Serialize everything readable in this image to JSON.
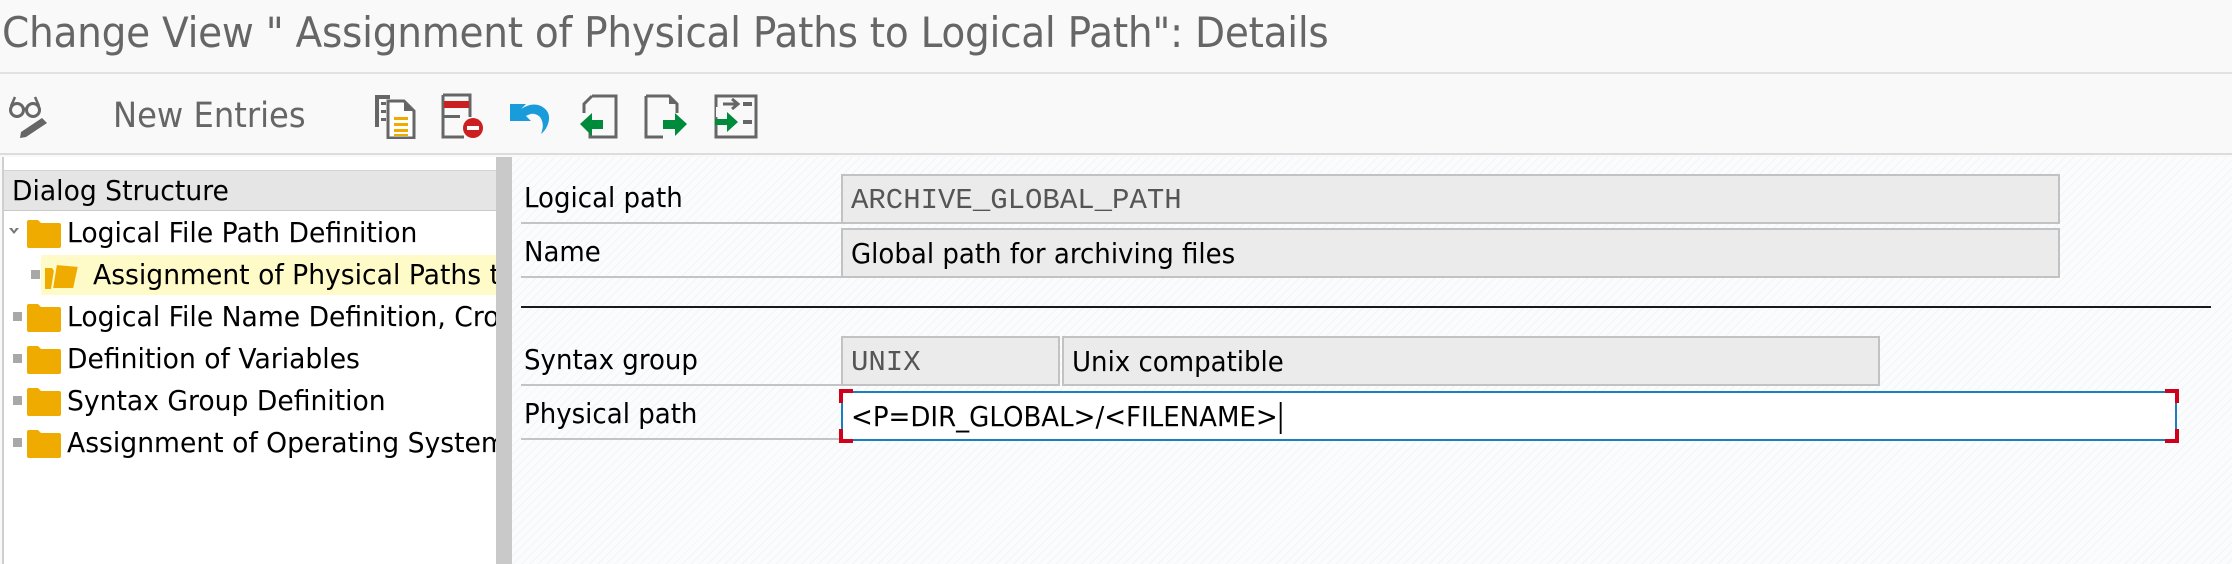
{
  "window": {
    "title": "Change View \" Assignment of Physical Paths to Logical Path\": Details"
  },
  "toolbar": {
    "display_change_icon": "glasses-pencil-icon",
    "new_entries_label": "New Entries",
    "buttons": [
      {
        "name": "copy-as",
        "icon": "copy-document-icon"
      },
      {
        "name": "delete",
        "icon": "delete-row-icon"
      },
      {
        "name": "undo-change",
        "icon": "undo-icon"
      },
      {
        "name": "previous-entry",
        "icon": "previous-entry-icon"
      },
      {
        "name": "next-entry",
        "icon": "next-entry-icon"
      },
      {
        "name": "select-block",
        "icon": "select-block-icon"
      }
    ]
  },
  "dialog_structure": {
    "header": "Dialog Structure",
    "items": [
      {
        "label": "Logical File Path Definition",
        "level": 0,
        "expanded": true,
        "selected": false,
        "icon": "folder-icon"
      },
      {
        "label": "Assignment of Physical Paths to Logical Path",
        "level": 1,
        "expanded": false,
        "selected": true,
        "icon": "folder-open-icon"
      },
      {
        "label": "Logical File Name Definition, Cross-Client",
        "level": 0,
        "expanded": false,
        "selected": false,
        "icon": "folder-icon"
      },
      {
        "label": "Definition of Variables",
        "level": 0,
        "expanded": false,
        "selected": false,
        "icon": "folder-icon"
      },
      {
        "label": "Syntax Group Definition",
        "level": 0,
        "expanded": false,
        "selected": false,
        "icon": "folder-icon"
      },
      {
        "label": "Assignment of Operating System to Syntax Group",
        "level": 0,
        "expanded": false,
        "selected": false,
        "icon": "folder-icon"
      }
    ]
  },
  "details": {
    "logical_path": {
      "label": "Logical path",
      "value": "ARCHIVE_GLOBAL_PATH"
    },
    "name": {
      "label": "Name",
      "value": "Global path for archiving files"
    },
    "syntax_group": {
      "label": "Syntax group",
      "value": "UNIX",
      "description": "Unix compatible"
    },
    "physical_path": {
      "label": "Physical path",
      "value": "<P=DIR_GLOBAL>/<FILENAME>"
    }
  },
  "colors": {
    "folder": "#f0ab00",
    "selection_highlight": "#fffbc8",
    "active_input_border": "#1b7fbd",
    "focus_bracket": "#d0021b"
  }
}
